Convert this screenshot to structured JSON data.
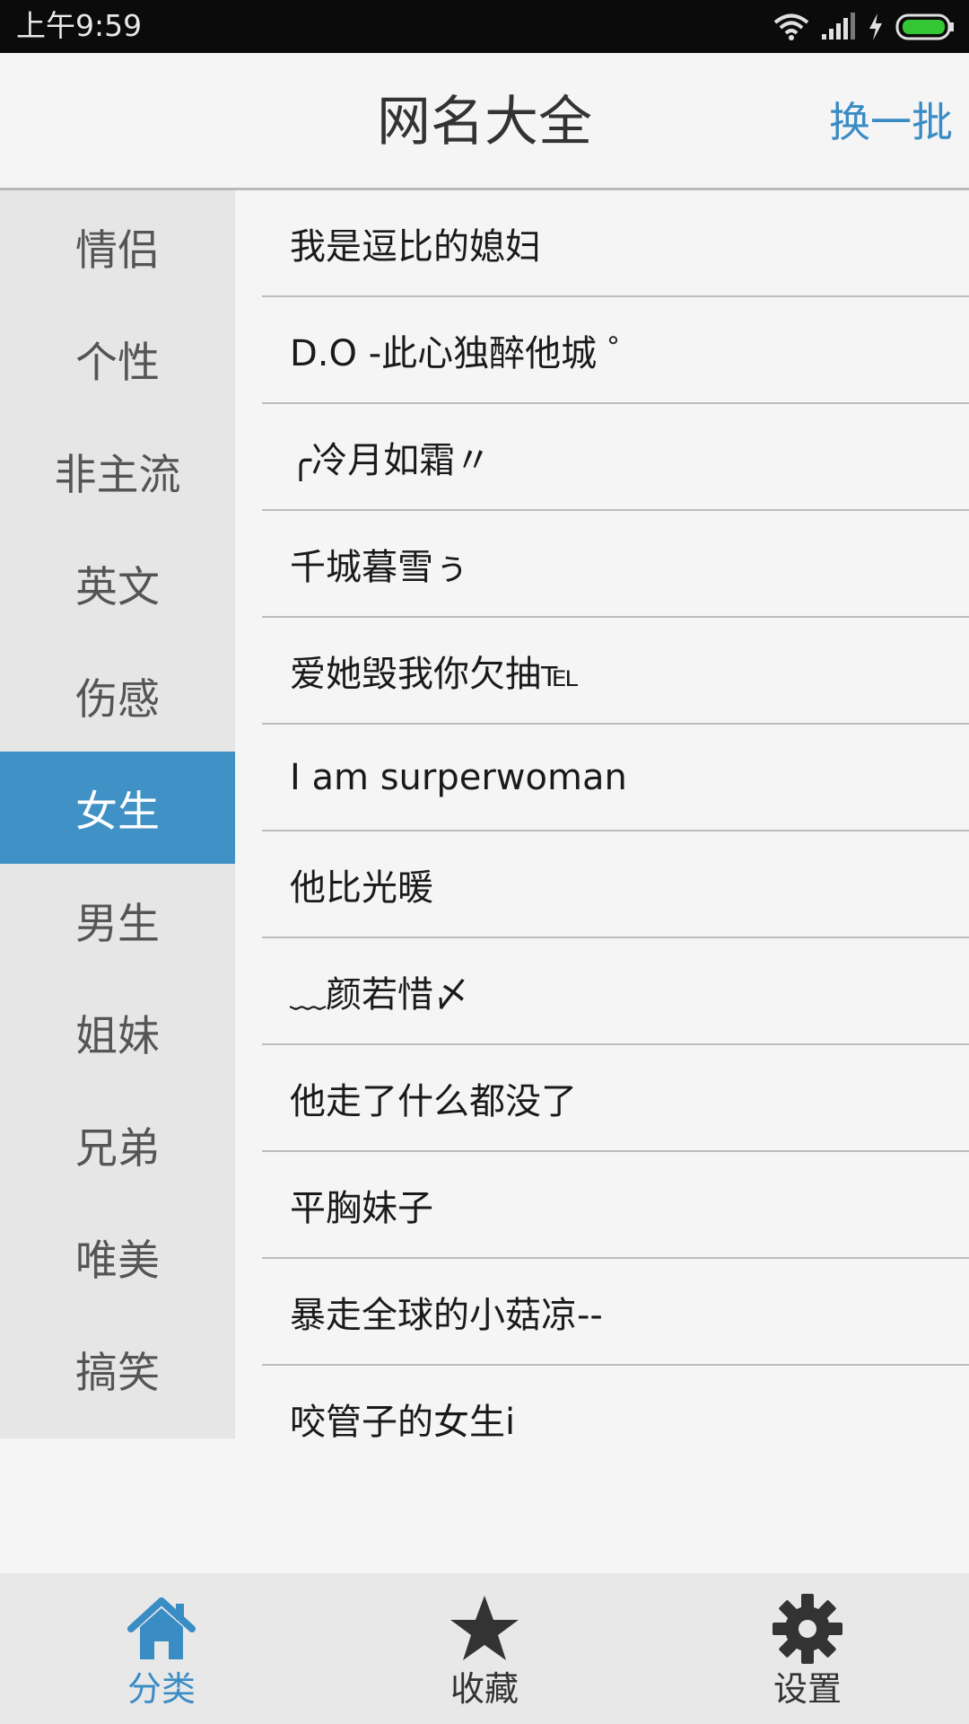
{
  "status_bar": {
    "time": "上午9:59"
  },
  "header": {
    "title": "网名大全",
    "refresh_label": "换一批"
  },
  "sidebar": {
    "active_index": 5,
    "items": [
      {
        "label": "情侣"
      },
      {
        "label": "个性"
      },
      {
        "label": "非主流"
      },
      {
        "label": "英文"
      },
      {
        "label": "伤感"
      },
      {
        "label": "女生"
      },
      {
        "label": "男生"
      },
      {
        "label": "姐妹"
      },
      {
        "label": "兄弟"
      },
      {
        "label": "唯美"
      },
      {
        "label": "搞笑"
      }
    ]
  },
  "names": [
    "我是逗比的媳妇",
    "D.O -此心独醉他城 ゜",
    " ╭冷月如霜〃",
    "千城暮雪ぅ",
    "爱她毁我你欠抽℡",
    "I am surperwoman",
    "他比光暖",
    "﹏颜若惜〆",
    "他走了什么都没了",
    "平胸妹子",
    "暴走全球的小菇凉--",
    "咬管子的女生i"
  ],
  "tabbar": {
    "active_index": 0,
    "tabs": [
      {
        "label": "分类",
        "icon": "home-icon"
      },
      {
        "label": "收藏",
        "icon": "star-icon"
      },
      {
        "label": "设置",
        "icon": "gear-icon"
      }
    ]
  },
  "colors": {
    "accent": "#3f91c6",
    "tab_active": "#3a8cc5",
    "tab_inactive": "#333333"
  }
}
